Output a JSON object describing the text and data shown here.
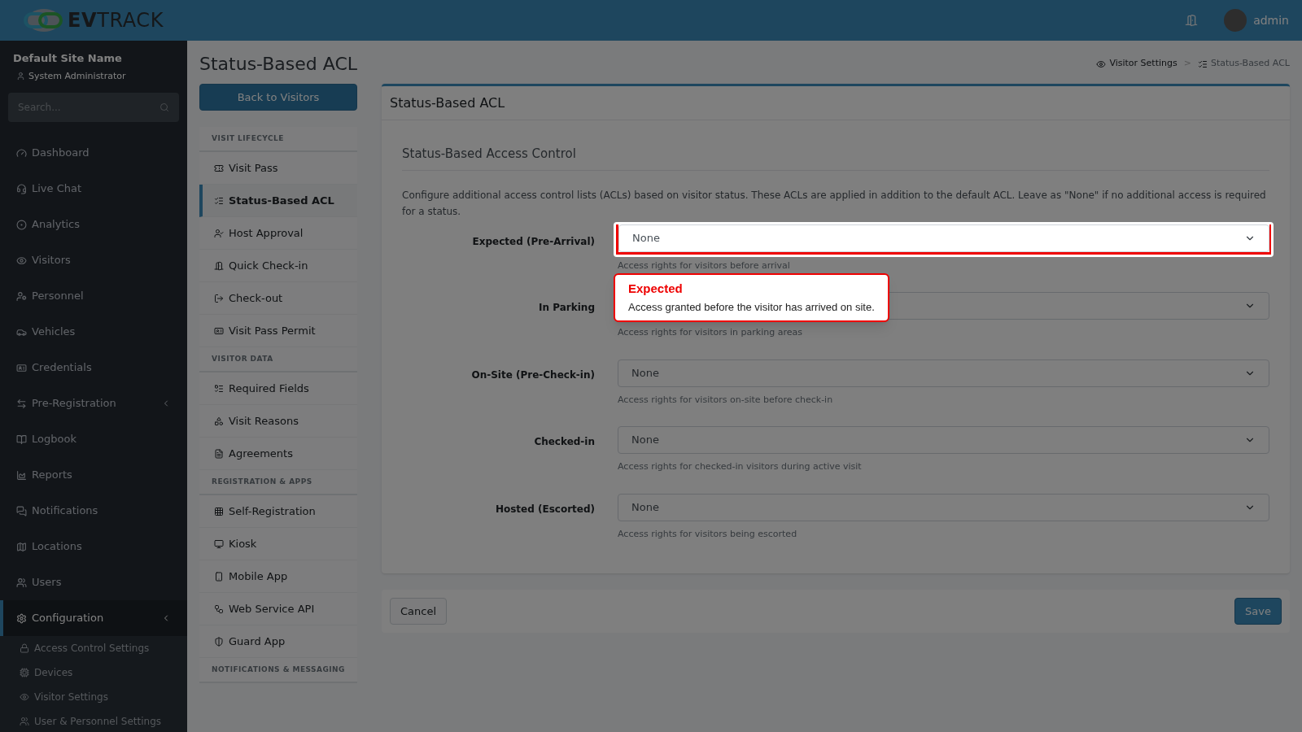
{
  "header": {
    "logo": "**EV**TRACK",
    "user": "admin"
  },
  "sidebar": {
    "site_name": "Default Site Name",
    "role": "System Administrator",
    "search": {
      "placeholder": "Search..."
    },
    "items": [
      {
        "label": "Dashboard",
        "selected": false
      },
      {
        "label": "Live Chat",
        "selected": false
      },
      {
        "label": "Analytics",
        "selected": false
      },
      {
        "label": "Visitors",
        "selected": false
      },
      {
        "label": "Personnel",
        "selected": false
      },
      {
        "label": "Vehicles",
        "selected": false
      },
      {
        "label": "Credentials",
        "selected": false
      },
      {
        "label": "Pre-Registration",
        "selected": false,
        "has_children": true
      },
      {
        "label": "Logbook",
        "selected": false
      },
      {
        "label": "Reports",
        "selected": false
      },
      {
        "label": "Notifications",
        "selected": false
      },
      {
        "label": "Locations",
        "selected": false
      },
      {
        "label": "Users",
        "selected": false
      },
      {
        "label": "Configuration",
        "selected": true,
        "expanded": true,
        "has_children": true,
        "children": [
          {
            "label": "Access Control Settings"
          },
          {
            "label": "Devices"
          },
          {
            "label": "Visitor Settings"
          },
          {
            "label": "User & Personnel Settings"
          }
        ]
      }
    ]
  },
  "page": {
    "title": "Status-Based ACL",
    "back_button": "Back to Visitors",
    "breadcrumb_separator": ">",
    "breadcrumb": [
      {
        "label": "Visitor Settings"
      },
      {
        "label": "Status-Based ACL"
      }
    ]
  },
  "subnav": [
    {
      "heading": "VISIT LIFECYCLE",
      "items": [
        {
          "label": "Visit Pass",
          "selected": false
        },
        {
          "label": "Status-Based ACL",
          "selected": true
        },
        {
          "label": "Host Approval",
          "selected": false
        },
        {
          "label": "Quick Check-in",
          "selected": false
        },
        {
          "label": "Check-out",
          "selected": false
        },
        {
          "label": "Visit Pass Permit",
          "selected": false
        }
      ]
    },
    {
      "heading": "VISITOR DATA",
      "items": [
        {
          "label": "Required Fields",
          "selected": false
        },
        {
          "label": "Visit Reasons",
          "selected": false
        },
        {
          "label": "Agreements",
          "selected": false
        }
      ]
    },
    {
      "heading": "REGISTRATION & APPS",
      "items": [
        {
          "label": "Self-Registration",
          "selected": false
        },
        {
          "label": "Kiosk",
          "selected": false
        },
        {
          "label": "Mobile App",
          "selected": false
        },
        {
          "label": "Web Service API",
          "selected": false
        },
        {
          "label": "Guard App",
          "selected": false
        }
      ]
    },
    {
      "heading": "NOTIFICATIONS & MESSAGING"
    }
  ],
  "card": {
    "title": "Status-Based ACL",
    "section_title": "Status-Based Access Control",
    "description": "Configure additional access control lists (ACLs) based on visitor status. These ACLs are applied in addition to the default ACL. Leave as \"None\" if no additional access is required for a status.",
    "fields": [
      {
        "label": "Expected (Pre-Arrival)",
        "value": "None",
        "hint": "Access rights for visitors before arrival",
        "highlighted": true
      },
      {
        "label": "In Parking",
        "hint": "Access rights for visitors in parking areas"
      },
      {
        "label": "On-Site (Pre-Check-in)",
        "value": "None",
        "hint": "Access rights for visitors on-site before check-in"
      },
      {
        "label": "Checked-in",
        "value": "None",
        "hint": "Access rights for checked-in visitors during active visit"
      },
      {
        "label": "Hosted (Escorted)",
        "value": "None",
        "hint": "Access rights for visitors being escorted"
      }
    ]
  },
  "footer": {
    "cancel": "Cancel",
    "save": "Save"
  },
  "tour_tooltip": {
    "title": "Expected",
    "text": "Access granted before the visitor has arrived on site."
  }
}
